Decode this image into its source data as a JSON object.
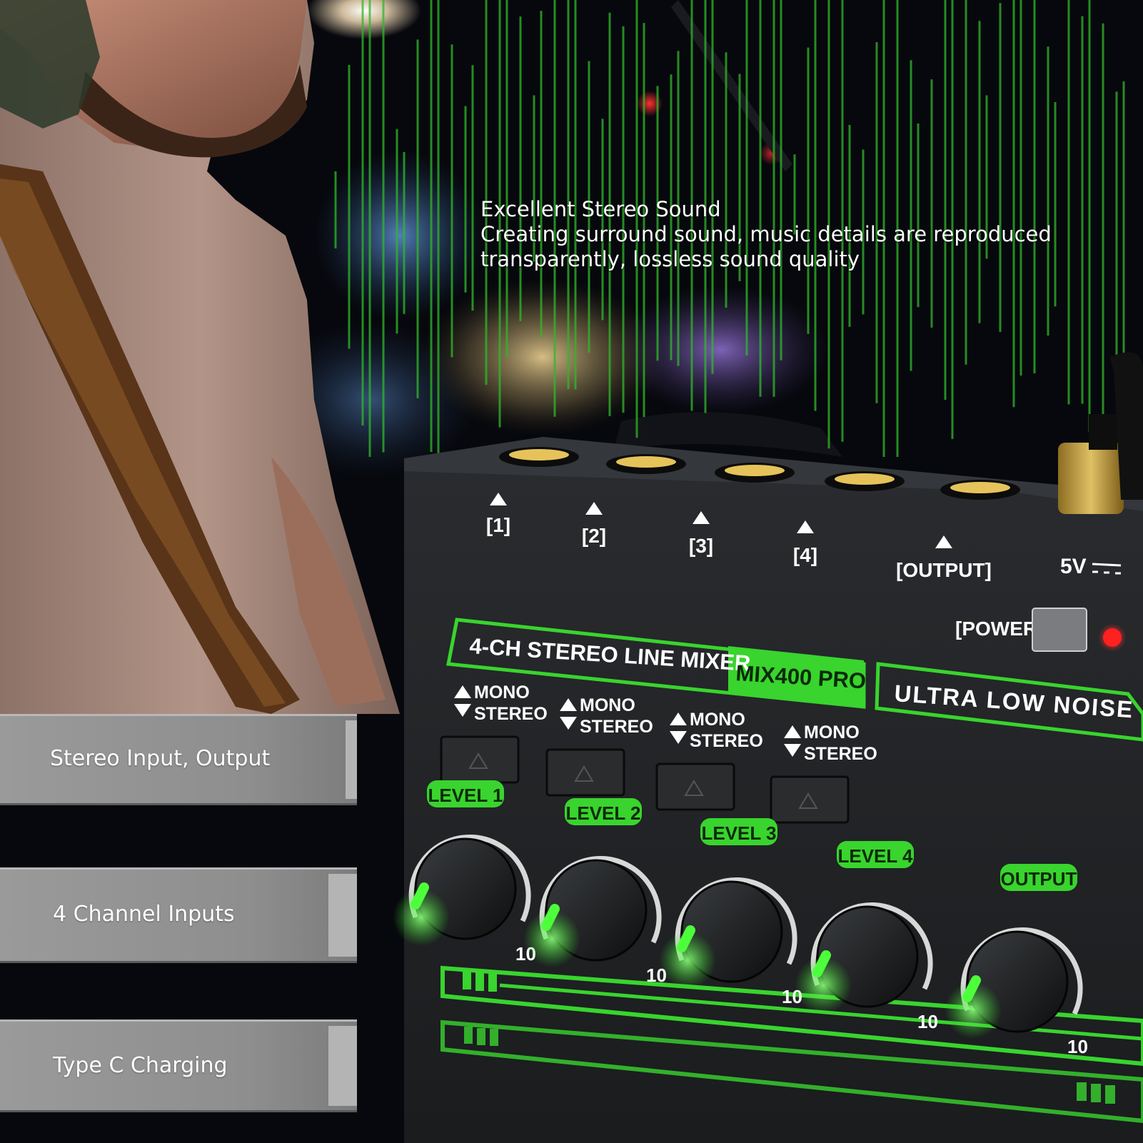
{
  "caption": {
    "heading": "Excellent Stereo Sound",
    "line1": "Creating surround sound, music details are reproduced",
    "line2": "transparently, lossless sound quality"
  },
  "features": [
    {
      "label": "Stereo Input, Output"
    },
    {
      "label": "4 Channel Inputs"
    },
    {
      "label": "Type C Charging"
    }
  ],
  "mixer": {
    "jacks": [
      "[1]",
      "[2]",
      "[3]",
      "[4]",
      "[OUTPUT]"
    ],
    "power_input": "5V",
    "power_label": "[POWER]",
    "model_title": "4-CH STEREO LINE MIXER",
    "model_name": "MIX400 PRO",
    "tagline": "ULTRA LOW NOISE",
    "mode_mono": "MONO",
    "mode_stereo": "STEREO",
    "knobs": [
      "LEVEL 1",
      "LEVEL 2",
      "LEVEL 3",
      "LEVEL 4",
      "OUTPUT"
    ],
    "scale_max": "10"
  },
  "colors": {
    "accent_green": "#39d42e",
    "panel": "#1b1d1f",
    "feature_bar": "#8e8e8e"
  }
}
